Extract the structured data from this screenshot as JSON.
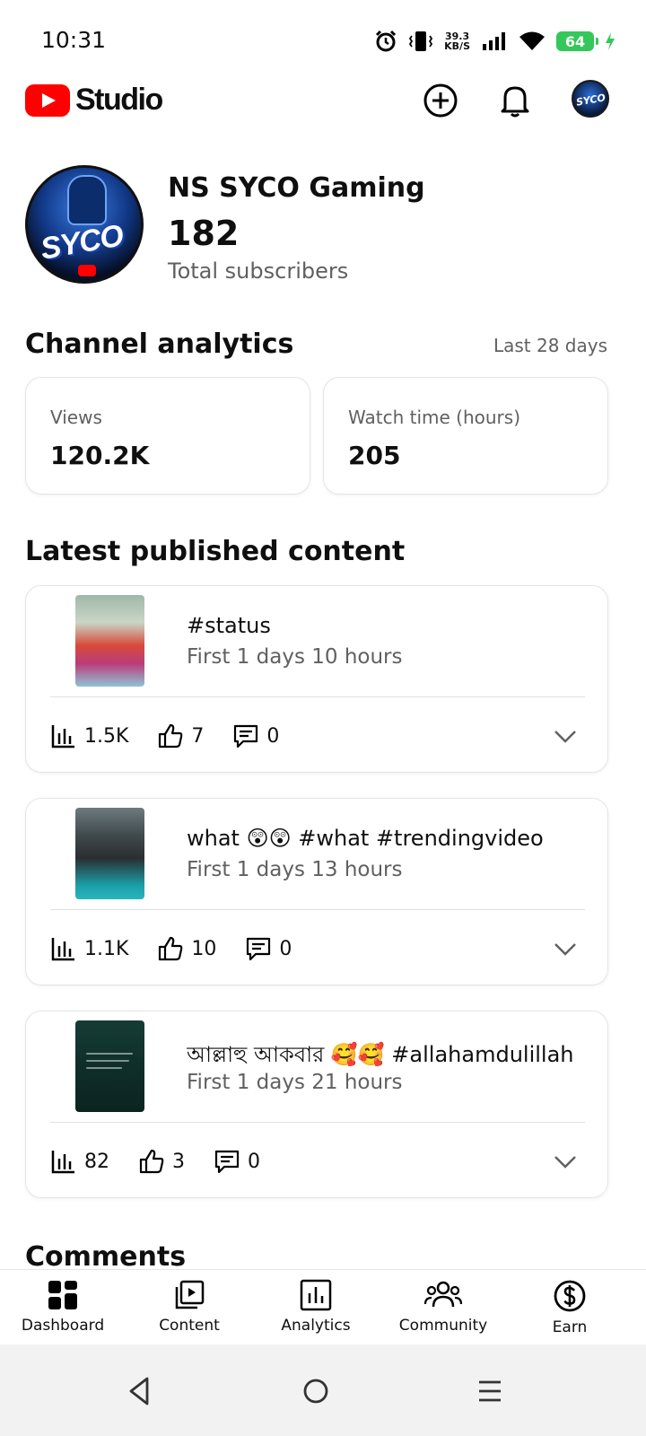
{
  "status_bar": {
    "time": "10:31",
    "net_speed_value": "39.3",
    "net_speed_unit": "KB/S",
    "battery": "64"
  },
  "header": {
    "brand": "Studio"
  },
  "profile": {
    "channel_name": "NS SYCO Gaming",
    "subscribers": "182",
    "subscribers_label": "Total subscribers",
    "avatar_text": "SYCO"
  },
  "analytics": {
    "title": "Channel analytics",
    "range": "Last 28 days",
    "cards": [
      {
        "label": "Views",
        "value": "120.2K"
      },
      {
        "label": "Watch time (hours)",
        "value": "205"
      }
    ]
  },
  "latest": {
    "title": "Latest published content",
    "items": [
      {
        "title": "#status",
        "subtitle": "First 1 days 10 hours",
        "views": "1.5K",
        "likes": "7",
        "comments": "0"
      },
      {
        "title": "what 😲😲 #what #trendingvideo",
        "subtitle": "First 1 days 13 hours",
        "views": "1.1K",
        "likes": "10",
        "comments": "0"
      },
      {
        "title": "আল্লাহু আকবার 🥰🥰 #allahamdulillah",
        "subtitle": "First 1 days 21 hours",
        "views": "82",
        "likes": "3",
        "comments": "0"
      }
    ]
  },
  "comments": {
    "title": "Comments"
  },
  "bottom_nav": {
    "items": [
      {
        "label": "Dashboard",
        "icon": "dashboard-icon"
      },
      {
        "label": "Content",
        "icon": "content-icon"
      },
      {
        "label": "Analytics",
        "icon": "analytics-icon"
      },
      {
        "label": "Community",
        "icon": "community-icon"
      },
      {
        "label": "Earn",
        "icon": "earn-icon"
      }
    ]
  },
  "colors": {
    "brand_red": "#ff0000",
    "battery_green": "#34c759",
    "text_secondary": "#606060"
  }
}
